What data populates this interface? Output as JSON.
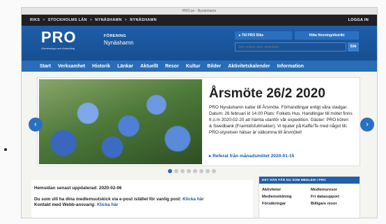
{
  "window": {
    "title": "PRO.se - Nynäshamn"
  },
  "breadcrumb": {
    "items": [
      "RIKS",
      "STOCKHOLMS LÄN",
      "NYNÄSHAMN",
      "NYNÄSHAMN"
    ],
    "separator": ">"
  },
  "account": {
    "login_label": "LOGGA IN"
  },
  "header": {
    "logo_text": "PRO",
    "logo_tagline": "Gemenskap och förändring",
    "org_kicker": "FÖRENING",
    "org_name": "Nynäshamn",
    "pro_riks_button": "Till PRO Riks",
    "find_button": "Hitta förening/distrikt",
    "search_placeholder": "Sök artiklar eller aktiviteter",
    "search_button": "Sök"
  },
  "nav": {
    "items": [
      {
        "label": "Start",
        "active": true
      },
      {
        "label": "Verksamhet"
      },
      {
        "label": "Historik"
      },
      {
        "label": "Länkar"
      },
      {
        "label": "Aktuellt"
      },
      {
        "label": "Resor"
      },
      {
        "label": "Kultur"
      },
      {
        "label": "Bilder"
      },
      {
        "label": "Aktivitetskalender"
      },
      {
        "label": "Information"
      }
    ]
  },
  "slider": {
    "title": "Årsmöte 26/2 2020",
    "body": "PRO Nynäshamn kallar till Årsmöte. Förhandlingar enligt våra stadgar. Datum: 26 februari kl 14.00 Plats: Folkets Hus. Handlingar till mötet finns fr.o.m 2020-02-20 att hämta utanför vår expedition. Gäster: PRO kören & Swedbank (Framtidsfullmakter). Vi bjuder på Kaffe/Te med något till. PRO-styrelsen hälsar är välkomna till årsmötet!",
    "link": "Referat från månadsmötet 2020-01-15",
    "image_icon": "flower-photo",
    "prev_icon": "chevron-left-icon",
    "next_icon": "chevron-right-icon",
    "dot_count": 8,
    "active_dot": 0
  },
  "page_info": {
    "updated": "Hemsidan senast uppdaterad: 2020-02-06",
    "contact_line1": "Du som vill ha dina medlemsutskick via e-post istället för vanlig post:",
    "contact_line1_link": "Klicka här",
    "contact_line2": "Kontakt med Webb-ansvarig:",
    "contact_line2_link": "Klicka här"
  },
  "member_box": {
    "heading": "DET HÄR FÅR DU SOM MEDLEM I PRO",
    "items": [
      "Aktiviteter",
      "Medlemsresor",
      "Medlemstidning",
      "Fri datasupport",
      "Försäkringar",
      "Billigare resor"
    ]
  },
  "colors": {
    "brand_blue": "#1e5ea9",
    "nav_blue": "#2a6cb5",
    "link_blue": "#1c5aa6"
  }
}
